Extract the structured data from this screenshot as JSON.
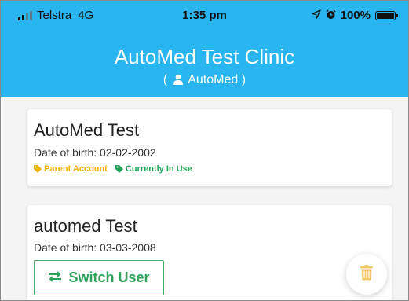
{
  "status_bar": {
    "carrier": "Telstra",
    "network": "4G",
    "time": "1:35 pm",
    "battery": "100%",
    "battery_level": 1.0,
    "icons": [
      "signal-icon",
      "location-arrow-icon",
      "alarm-icon",
      "battery-icon"
    ]
  },
  "header": {
    "title": "AutoMed Test Clinic",
    "subtitle_prefix": "(",
    "subtitle_user": "AutoMed",
    "subtitle_suffix": ")",
    "bg_color": "#29b6f0"
  },
  "profiles": [
    {
      "name": "AutoMed Test",
      "dob": "Date of birth: 02-02-2002",
      "tags": [
        {
          "label": "Parent Account",
          "color": "#f0b400"
        },
        {
          "label": "Currently In Use",
          "color": "#22a35a"
        }
      ]
    },
    {
      "name": "automed Test",
      "dob": "Date of birth: 03-03-2008",
      "switch_label": "Switch User"
    }
  ],
  "fab": {
    "icon": "trash-icon",
    "color": "#f3c66a"
  }
}
